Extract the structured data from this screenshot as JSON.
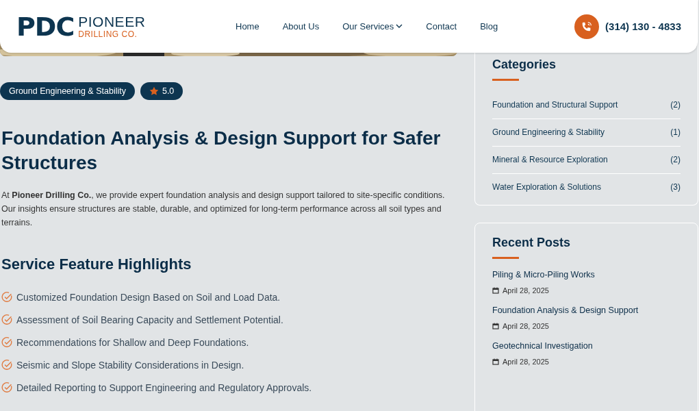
{
  "header": {
    "logo": {
      "mark": "PDC",
      "name": "PIONEER",
      "sub": "DRILLING CO."
    },
    "nav": [
      {
        "label": "Home",
        "dropdown": false
      },
      {
        "label": "About Us",
        "dropdown": false
      },
      {
        "label": "Our Services",
        "dropdown": true
      },
      {
        "label": "Contact",
        "dropdown": false
      },
      {
        "label": "Blog",
        "dropdown": false
      }
    ],
    "phone": "(314) 130 - 4833"
  },
  "tags": {
    "category": "Ground Engineering & Stability",
    "rating": "5.0"
  },
  "title": "Foundation Analysis & Design Support for Safer Structures",
  "intro": "At **Pioneer Drilling Co.**, we provide expert foundation analysis and design support tailored to site-specific conditions. Our insights ensure structures are stable, durable, and optimized for long-term performance across all soil types and terrains.",
  "features": {
    "heading": "Service Feature Highlights",
    "items": [
      "Customized Foundation Design Based on Soil and Load Data.",
      "Assessment of Soil Bearing Capacity and Settlement Potential.",
      "Recommendations for Shallow and Deep Foundations.",
      "Seismic and Slope Stability Considerations in Design.",
      "Detailed Reporting to Support Engineering and Regulatory Approvals."
    ]
  },
  "sidebar": {
    "categories": {
      "heading": "Categories",
      "items": [
        {
          "name": "Foundation and Structural Support",
          "count": "(2)"
        },
        {
          "name": "Ground Engineering & Stability",
          "count": "(1)"
        },
        {
          "name": "Mineral & Resource Exploration",
          "count": "(2)"
        },
        {
          "name": "Water Exploration & Solutions",
          "count": "(3)"
        }
      ]
    },
    "recent_posts": {
      "heading": "Recent Posts",
      "items": [
        {
          "title": "Piling & Micro-Piling Works",
          "date": "April 28, 2025"
        },
        {
          "title": "Foundation Analysis & Design Support",
          "date": "April 28, 2025"
        },
        {
          "title": "Geotechnical Investigation",
          "date": "April 28, 2025"
        }
      ]
    }
  }
}
